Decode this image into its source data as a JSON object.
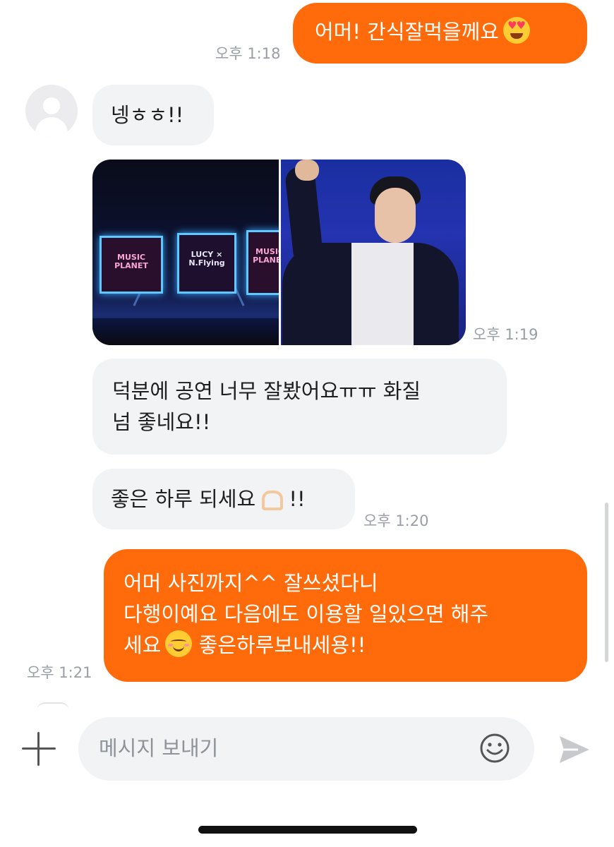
{
  "messages": [
    {
      "id": "m1",
      "side": "out",
      "text": "어머! 간식잘먹을께요",
      "emoji": "heart-eyes-emoji",
      "time": "오후 1:18"
    },
    {
      "id": "m2",
      "side": "in",
      "text": "넹ㅎㅎ!!"
    },
    {
      "id": "m3",
      "side": "in",
      "type": "photos",
      "images": [
        "concert-stage-photo",
        "performer-photo"
      ],
      "stage_screen_texts": [
        "MUSIC PLANET",
        "LUCY × N.Flying",
        "MUSIC PLANET"
      ],
      "time": "오후 1:19"
    },
    {
      "id": "m4",
      "side": "in",
      "lines": [
        "덕분에 공연 너무 잘봤어요ㅠㅠ 화질",
        "넘 좋네요!!"
      ]
    },
    {
      "id": "m5",
      "side": "in",
      "text_before": "좋은 하루 되세요",
      "emoji": "heart-hands-emoji",
      "text_after": " !!",
      "time": "오후 1:20"
    },
    {
      "id": "m6",
      "side": "out",
      "lines": [
        "어머 사진까지^^ 잘쓰셨다니",
        "다행이예요 다음에도 이용할 일있으면 해주"
      ],
      "line3_before": "세요",
      "line3_emoji": "smiling-blush-emoji",
      "line3_after": " 좋은하루보내세용!!",
      "time": "오후 1:21"
    }
  ],
  "composer": {
    "placeholder": "메시지 보내기"
  },
  "icons": {
    "add": "plus-icon",
    "emoji": "smiley-icon",
    "send": "send-icon"
  },
  "colors": {
    "outgoing": "#ff6b0a",
    "incoming": "#f2f3f5",
    "time": "#9a9ea5"
  }
}
